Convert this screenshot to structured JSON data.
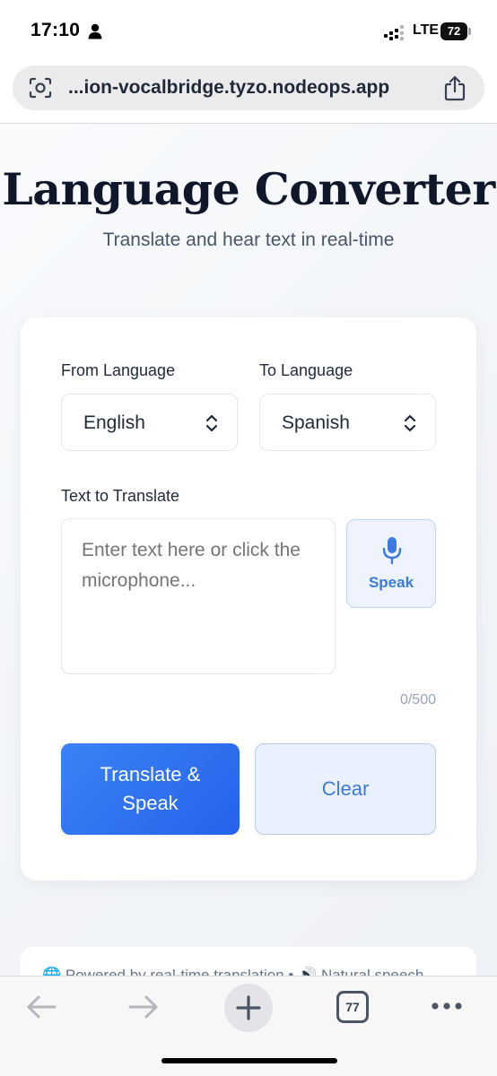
{
  "status_bar": {
    "time": "17:10",
    "network": "LTE",
    "battery": "72",
    "icons": [
      "person-icon",
      "signal-icon",
      "battery-icon"
    ]
  },
  "browser": {
    "url": "...ion-vocalbridge.tyzo.nodeops.app",
    "tab_count": "77",
    "icons": [
      "lens-icon",
      "share-icon",
      "back-arrow-icon",
      "forward-arrow-icon",
      "plus-icon",
      "more-icon"
    ]
  },
  "header": {
    "title": "Language Converter",
    "subtitle": "Translate and hear text in real-time"
  },
  "form": {
    "from_label": "From Language",
    "from_value": "English",
    "to_label": "To Language",
    "to_value": "Spanish",
    "text_label": "Text to Translate",
    "text_placeholder": "Enter text here or click the microphone...",
    "speak_label": "Speak",
    "char_count": "0/500",
    "translate_label": "Translate & Speak",
    "clear_label": "Clear"
  },
  "footer": {
    "text": "🌐 Powered by real-time translation • 🔊 Natural speech"
  },
  "colors": {
    "accent": "#2563eb",
    "title": "#0f172a",
    "secondary_button_bg": "#eaf0fd"
  }
}
